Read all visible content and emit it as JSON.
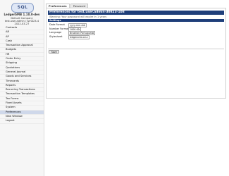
{
  "app": {
    "logo_text": "SQL",
    "version": "LedgerSMB 1.10.0-dev",
    "company": "Default Company",
    "user": "test.user.admin / lsmb23-4",
    "date": "2022-03-27"
  },
  "menu": [
    "Contacts",
    "AR",
    "AP",
    "Cash",
    "Transaction Approval",
    "Budgets",
    "HR",
    "Order Entry",
    "Shipping",
    "Quotations",
    "General Journal",
    "Goods and Services",
    "Timecards",
    "Reports",
    "Recurring Transactions",
    "Transaction Templates",
    "Tax Forms",
    "Fixed Assets",
    "System",
    "Preferences",
    "New Window",
    "Logout"
  ],
  "active_menu": "Preferences",
  "tabs": [
    {
      "label": "Preferences",
      "active": true
    },
    {
      "label": "Password",
      "active": false
    }
  ],
  "preferences": {
    "title": "Preferences for test.user.admin-30823-108",
    "warning": "Warning: Your password will expire in 1 years",
    "section_title": "Settings",
    "fields": [
      {
        "label": "Date Format",
        "value": "yyyy-mm-dd"
      },
      {
        "label": "Number Format",
        "value": "1000.00"
      },
      {
        "label": "Language",
        "value": "Brazilian Portuguese"
      },
      {
        "label": "Stylesheet",
        "value": "ledgersmb.css"
      }
    ],
    "save_label": "Save"
  }
}
